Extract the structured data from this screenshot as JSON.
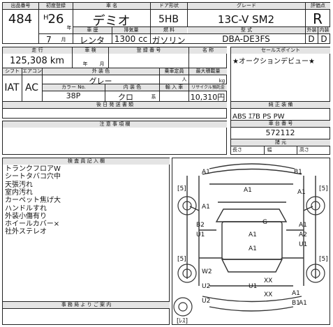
{
  "header": {
    "labels": {
      "lot": "出品番号",
      "first_reg": "初度登録",
      "model": "車 名",
      "doors": "ドア形状",
      "grade": "グレード",
      "rating": "評価点",
      "era_suffix": "年",
      "month_suffix": "月",
      "usage": "車 歴",
      "displacement": "排気量",
      "fuel": "燃 料",
      "type": "型 式",
      "exterior": "外装",
      "interior": "内装"
    },
    "lot_no": "484",
    "era": "H",
    "year": "26",
    "month": "7",
    "model_name": "デミオ",
    "door_type": "5HB",
    "grade_name": "13C-V SM2",
    "overall_rating": "R",
    "usage_value": "レンタ",
    "displacement_value": "1300 cc",
    "fuel_value": "ガソリン",
    "type_value": "DBA-DE3FS",
    "exterior_rating": "D",
    "interior_rating": "D"
  },
  "specs": {
    "labels": {
      "mileage": "走 行",
      "inspection": "車 検",
      "reg_no": "登 録 番 号",
      "eq_name": "名 称",
      "shift": "シフト",
      "ac": "エアコン",
      "ext_color": "外 装 色",
      "capacity": "乗車定員",
      "max_load": "最大積載量",
      "color_no": "カラー No.",
      "int_color": "内 装 色",
      "import": "輸 入 車",
      "recycle": "リサイクル預託金",
      "post": "後 日 発 送 書 類",
      "seal_point": "セールスポイント",
      "options": "純 正 装 備",
      "frame_no": "車 台 番 号",
      "dims": "諸 元",
      "len": "長さ",
      "wid": "幅",
      "hgt": "高さ",
      "notes": "注 意 事 項 欄"
    },
    "inspection_year": "年",
    "inspection_month": "月",
    "mileage_value": "125,308 km",
    "shift_value": "IAT",
    "ac_value": "AC",
    "ext_color_value": "グレー",
    "capacity_unit": "人",
    "load_unit": "kg",
    "color_no_value": "38P",
    "int_color_value": "クロ",
    "int_suffix": "系",
    "recycle_value": "10,310円",
    "sales_point": "★オークションデビュー★",
    "options_value": "ABS ｴｱB PS PW",
    "frame_no_value": "572112"
  },
  "inspection": {
    "title": "検 査 員 記 入 欄",
    "comments": [
      "トランクフロアW",
      "シートタバコ穴中",
      "天張汚れ",
      "室内汚れ",
      "カーペット焦げ大",
      "ハンドルすれ",
      "外装小傷有り",
      "ホイールカバー×",
      "社外ステレオ"
    ],
    "office_title": "事 務 局 よ り ご 案 内"
  },
  "diagram": {
    "marks": [
      "A1",
      "B1",
      "A1",
      "A1",
      "G",
      "B2",
      "U1",
      "A1",
      "A2",
      "U1",
      "A1",
      "A1",
      "W2",
      "U2",
      "XX",
      "XX",
      "[5]",
      "[5]",
      "[5]",
      "[5]",
      "[ﾚｽ]",
      "U2",
      "U1",
      "A1",
      "B1",
      "A1",
      "A1"
    ]
  }
}
